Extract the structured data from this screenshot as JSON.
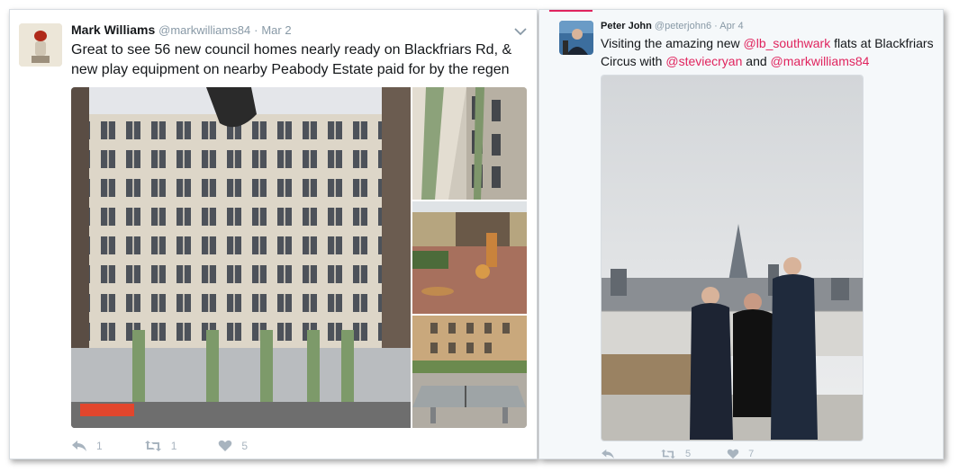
{
  "tweet1": {
    "name": "Mark Williams",
    "handle": "@markwilliams84",
    "dot": "·",
    "date": "Mar 2",
    "text": "Great to see 56 new council homes nearly ready on Blackfriars Rd, & new play equipment on nearby Peabody Estate paid for by the regen",
    "actions": {
      "reply_count": "1",
      "retweet_count": "1",
      "like_count": "5"
    }
  },
  "tweet2": {
    "name": "Peter John",
    "handle": "@peterjohn6",
    "dot": "·",
    "date": "Apr 4",
    "text_parts": {
      "p1": "Visiting the amazing new ",
      "m1": "@lb_southwark",
      "p2": " flats at Blackfriars Circus with ",
      "m2": "@steviecryan",
      "p3": " and ",
      "m3": "@markwilliams84"
    },
    "actions": {
      "retweet_count": "5",
      "like_count": "7"
    }
  },
  "colors": {
    "accent": "#e0245e",
    "muted": "#8899a6",
    "icon": "#a8b4bf"
  }
}
